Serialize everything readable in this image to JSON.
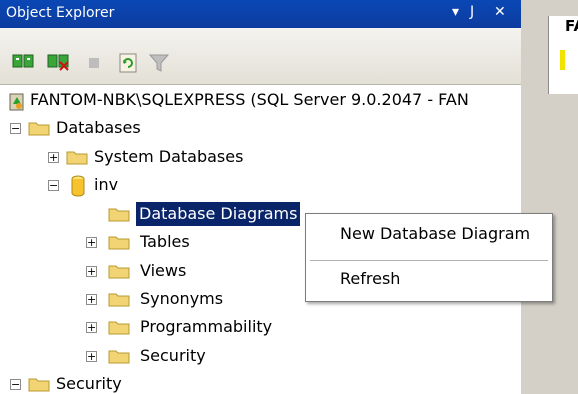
{
  "window": {
    "title": "Object Explorer",
    "pin_glyph": "↓ &#x4f;"
  },
  "titlebar_buttons": {
    "dropdown": "▾",
    "pin": "I",
    "close": "✕"
  },
  "toolbar": {
    "icons": [
      "connect-icon",
      "disconnect-icon",
      "stop-icon",
      "refresh-icon",
      "filter-icon"
    ]
  },
  "tree": {
    "server": "FANTOM-NBK\\SQLEXPRESS (SQL Server 9.0.2047 - FAN",
    "databases": "Databases",
    "system_databases": "System Databases",
    "db_name": "inv",
    "db_children": {
      "database_diagrams": "Database Diagrams",
      "tables": "Tables",
      "views": "Views",
      "synonyms": "Synonyms",
      "programmability": "Programmability",
      "security": "Security"
    },
    "root_security": "Security"
  },
  "context_menu": {
    "new_diagram": "New Database Diagram",
    "refresh": "Refresh"
  },
  "side_tab": {
    "label": "FA"
  },
  "colors": {
    "title_bar": "#0a47b5",
    "selection": "#0a246a",
    "folder": "#f2d474",
    "db": "#f6c32e"
  }
}
